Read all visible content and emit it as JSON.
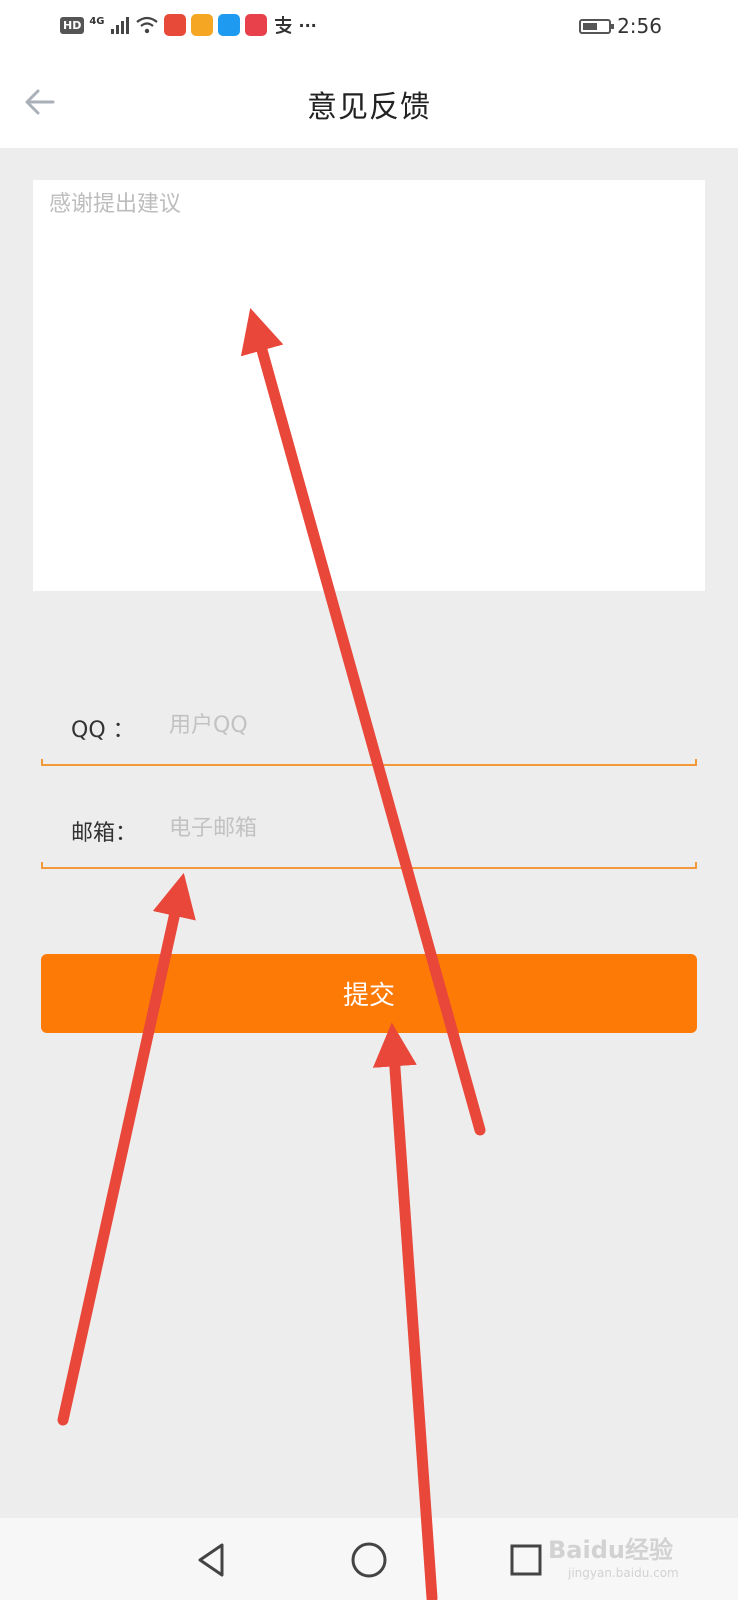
{
  "status_bar": {
    "network_badge": "HD",
    "network_type": "4G",
    "time": "2:56",
    "more": "···",
    "app_icon_colors": [
      "#e84a3a",
      "#f5a623",
      "#1e9bf0",
      "#e8414b"
    ]
  },
  "header": {
    "title": "意见反馈"
  },
  "feedback": {
    "placeholder": "感谢提出建议"
  },
  "form": {
    "qq": {
      "label": "QQ  ：",
      "placeholder": "用户QQ"
    },
    "email": {
      "label": "邮箱：",
      "placeholder": "电子邮箱"
    }
  },
  "submit": {
    "label": "提交"
  },
  "watermark": {
    "text": "Baidu经验",
    "sub": "jingyan.baidu.com"
  },
  "colors": {
    "accent": "#fd7a07",
    "underline": "#f29a3a",
    "annotation": "#e8473a",
    "background": "#ededed"
  }
}
